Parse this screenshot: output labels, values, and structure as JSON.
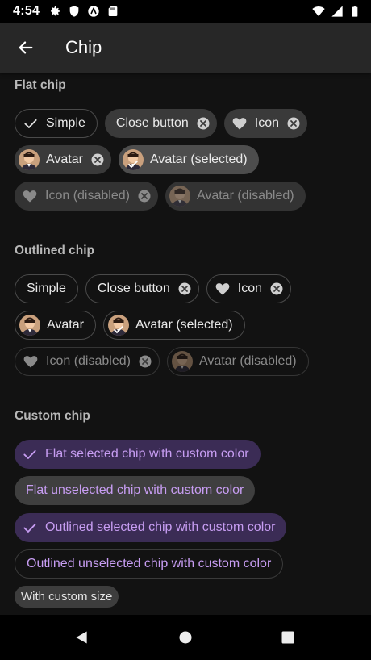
{
  "status": {
    "time": "4:54"
  },
  "toolbar": {
    "title": "Chip"
  },
  "flat": {
    "title": "Flat chip",
    "simple": "Simple",
    "close_button": "Close button",
    "icon": "Icon",
    "avatar": "Avatar",
    "avatar_selected": "Avatar (selected)",
    "icon_disabled": "Icon (disabled)",
    "avatar_disabled": "Avatar (disabled)"
  },
  "outlined": {
    "title": "Outlined chip",
    "simple": "Simple",
    "close_button": "Close button",
    "icon": "Icon",
    "avatar": "Avatar",
    "avatar_selected": "Avatar (selected)",
    "icon_disabled": "Icon (disabled)",
    "avatar_disabled": "Avatar (disabled)"
  },
  "custom": {
    "title": "Custom chip",
    "flat_selected": "Flat selected chip with custom color",
    "flat_unselected": "Flat unselected chip with custom color",
    "outlined_selected": "Outlined selected chip with custom color",
    "outlined_unselected": "Outlined unselected chip with custom color",
    "custom_size": "With custom size"
  },
  "colors": {
    "accent": "#c79df2",
    "background": "#121212",
    "toolbar": "#272727"
  }
}
